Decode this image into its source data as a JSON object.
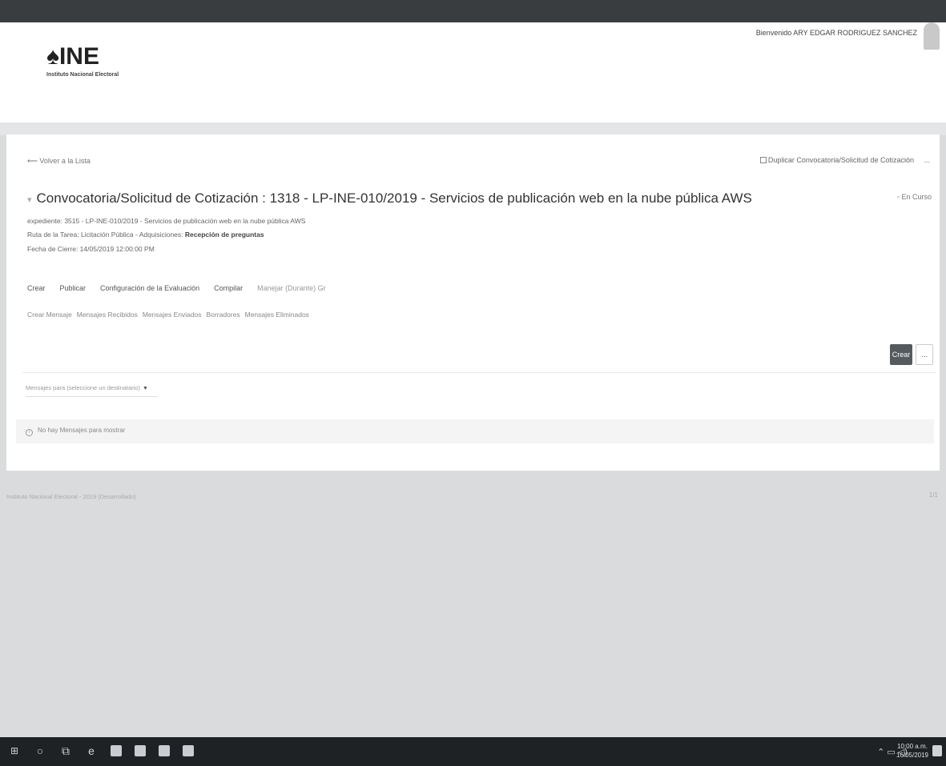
{
  "header": {
    "logo_text": "INE",
    "logo_subtitle": "Instituto Nacional Electoral",
    "welcome": "Bienvenido ARY EDGAR RODRIGUEZ SANCHEZ"
  },
  "page": {
    "back_link": "Volver a la Lista",
    "duplicate_action": "Duplicar Convocatoria/Solicitud de Cotización",
    "more_label": "...",
    "title": "Convocatoria/Solicitud de Cotización : 1318 - LP-INE-010/2019 - Servicios de publicación web en la nube pública AWS",
    "status": "En Curso",
    "meta": {
      "expediente": "expediente: 3515 - LP-INE-010/2019 - Servicios de publicación web en la nube pública AWS",
      "ruta_prefix": "Ruta de la Tarea: Licitación Pública - Adquisiciones: ",
      "ruta_stage": "Recepción de preguntas",
      "fecha": "Fecha de Cierre: 14/05/2019 12:00:00 PM"
    },
    "tabs": [
      "Crear",
      "Publicar",
      "Configuración de la Evaluación",
      "Compilar",
      "Manejar (Durante) Gr"
    ],
    "subtabs": [
      "Crear Mensaje",
      "Mensajes Recibidos",
      "Mensajes Enviados",
      "Borradores",
      "Mensajes Eliminados"
    ],
    "crear_button": "Crear",
    "filter_placeholder": "Mensajes para (seleccione un destinatario)",
    "empty_message": "No hay Mensajes para mostrar"
  },
  "footer": {
    "text": "Instituto Nacional Electoral - 2019 (Desarrollado)",
    "right": "1/1"
  },
  "taskbar": {
    "icons": [
      "windows-icon",
      "cortana-icon",
      "task-view-icon",
      "edge-icon",
      "outlook-icon",
      "chrome-icon",
      "file-icon",
      "excel-icon"
    ],
    "tray": "⌃ ▭ ◁)",
    "time": "10:00 a.m.",
    "date": "16/05/2019"
  }
}
